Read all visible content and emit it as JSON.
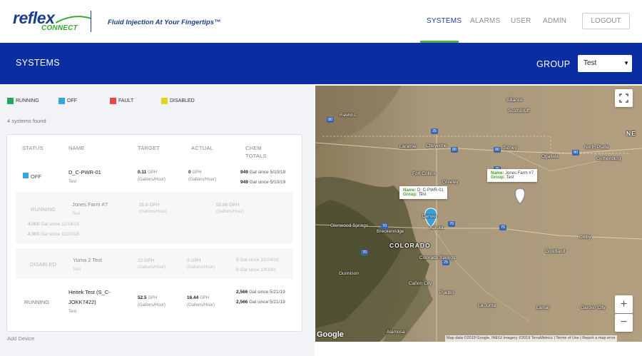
{
  "brand": {
    "logo_main": "reflex",
    "logo_sub": "CONNECT",
    "tagline": "Fluid Injection At Your Fingertips™"
  },
  "nav": {
    "systems": "SYSTEMS",
    "alarms": "ALARMS",
    "user": "USER",
    "admin": "ADMIN",
    "logout": "LOGOUT"
  },
  "header": {
    "title": "SYSTEMS",
    "group_label": "GROUP",
    "group_selected": "Test"
  },
  "legend": {
    "running": "RUNNING",
    "off": "OFF",
    "fault": "FAULT",
    "disabled": "DISABLED",
    "colors": {
      "running": "#1fa85a",
      "off": "#34a7dc",
      "fault": "#e84646",
      "disabled": "#e6d21d"
    }
  },
  "systems_found": "4 systems found",
  "table": {
    "headers": {
      "status": "STATUS",
      "name": "NAME",
      "target": "TARGET",
      "actual": "ACTUAL",
      "chem": "CHEM",
      "totals": "TOTALS"
    },
    "rows": [
      {
        "status": "OFF",
        "name": "D_C-PWR-01",
        "group": "Test",
        "target_value": "0.11",
        "target_unit": "GPH",
        "target_sub": "(Gallons/Hour)",
        "actual_value": "0",
        "actual_unit": "GPH",
        "actual_sub": "(Gallons/Hour)",
        "chem1_value": "949",
        "chem1_text": "Gal since 5/10/19",
        "chem2_value": "949",
        "chem2_text": "Gal since 5/10/19"
      },
      {
        "status": "RUNNING",
        "name": "Jones Farm #7",
        "group": "Test",
        "target_value": "55.6",
        "target_unit": "GPH",
        "target_sub": "(Gallons/Hour)",
        "actual_value": "55.88",
        "actual_unit": "GPH",
        "actual_sub": "(Gallons/Hour)",
        "chem1_value": "4,000",
        "chem1_text": "Gal since 11/14/18",
        "chem2_value": "4,000",
        "chem2_text": "Gal since 11/20/18"
      },
      {
        "status": "DISABLED",
        "name": "Yuma 2 Test",
        "group": "Test",
        "target_value": "22",
        "target_unit": "GPH",
        "target_sub": "(Gallons/Hour)",
        "actual_value": "0",
        "actual_unit": "GPH",
        "actual_sub": "(Gallons/Hour)",
        "chem1_value": "0",
        "chem1_text": "Gal since 10/24/18",
        "chem2_value": "0",
        "chem2_text": "Gal since 1/01/01"
      },
      {
        "status": "RUNNING",
        "name_line1": "Heitek Test (S_C-",
        "name_line2": "JOKK7422)",
        "group": "Test",
        "target_value": "52.5",
        "target_unit": "GPH",
        "target_sub": "(Gallons/Hour)",
        "actual_value": "16.44",
        "actual_unit": "GPH",
        "actual_sub": "(Gallons/Hour)",
        "chem1_value": "2,566",
        "chem1_text": "Gal since 5/21/19",
        "chem2_value": "2,566",
        "chem2_text": "Gal since 5/21/19"
      }
    ]
  },
  "add_device": "Add Device",
  "map": {
    "info1": {
      "name_key": "Name:",
      "name": "D_C-PWR-01",
      "group_key": "Group:",
      "group": "Test"
    },
    "info2": {
      "name_key": "Name:",
      "name": "Jones Farm #7",
      "group_key": "Group:",
      "group": "Test"
    },
    "places": [
      "Scottsbluff",
      "Alliance",
      "Rawlins",
      "Cheyenne",
      "Sidney",
      "North Platte",
      "Ogallala",
      "Gothenburg",
      "Laramie",
      "Fort Collins",
      "Greeley",
      "Denver",
      "Aurora",
      "Glenwood Springs",
      "Breckenridge",
      "COLORADO",
      "Colorado Springs",
      "Cañon City",
      "Pueblo",
      "Gunnison",
      "La Junta",
      "Lamar",
      "Garden City",
      "Colby",
      "Goodland",
      "Alamosa"
    ],
    "google": "Google",
    "attribution": "Map data ©2019 Google, INEGI Imagery ©2019 TerraMetrics | Terms of Use | Report a map error",
    "zoom_in": "+",
    "zoom_out": "−",
    "edge_letter": "NE",
    "routes": [
      "80",
      "25",
      "80",
      "80",
      "80",
      "76",
      "70",
      "70",
      "70",
      "70",
      "25"
    ],
    "marker_colors": {
      "blue": "#3aa0d8",
      "gray": "#8a8a8a"
    }
  }
}
